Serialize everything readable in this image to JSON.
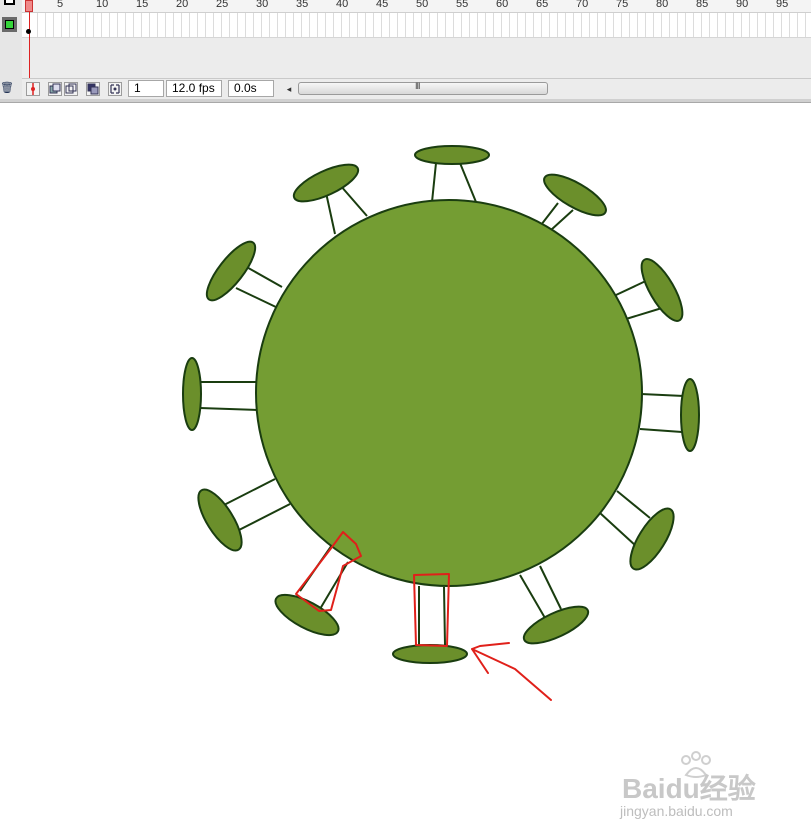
{
  "timeline": {
    "ruler_labels": [
      "5",
      "10",
      "15",
      "20",
      "25",
      "30",
      "35",
      "40",
      "45",
      "50",
      "55",
      "60",
      "65",
      "70",
      "75",
      "80",
      "85",
      "90",
      "95"
    ],
    "current_frame": "1",
    "frame_rate": "12.0 fps",
    "elapsed_time": "0.0s",
    "scroll_left_glyph": "◂",
    "scroll_grip_glyph": "III"
  },
  "icons": {
    "layer_outline": "square-outline-icon",
    "layer_color": "green-layer-color-icon",
    "trash": "trash-icon",
    "center_frame": "center-frame-icon",
    "onion_skin": "onion-skin-icon",
    "onion_skin_outlines": "onion-skin-outlines-icon",
    "edit_multiple_frames": "edit-multiple-frames-icon",
    "modify_onion_markers": "modify-onion-markers-icon"
  },
  "colors": {
    "virus_body": "#749d33",
    "virus_stroke": "#1a3d10",
    "spike_head": "#6b8f2b",
    "annotation_red": "#e0201a",
    "layer_green": "#35d43a"
  },
  "watermark": {
    "logo_text": "Baidu经验",
    "url": "jingyan.baidu.com"
  }
}
